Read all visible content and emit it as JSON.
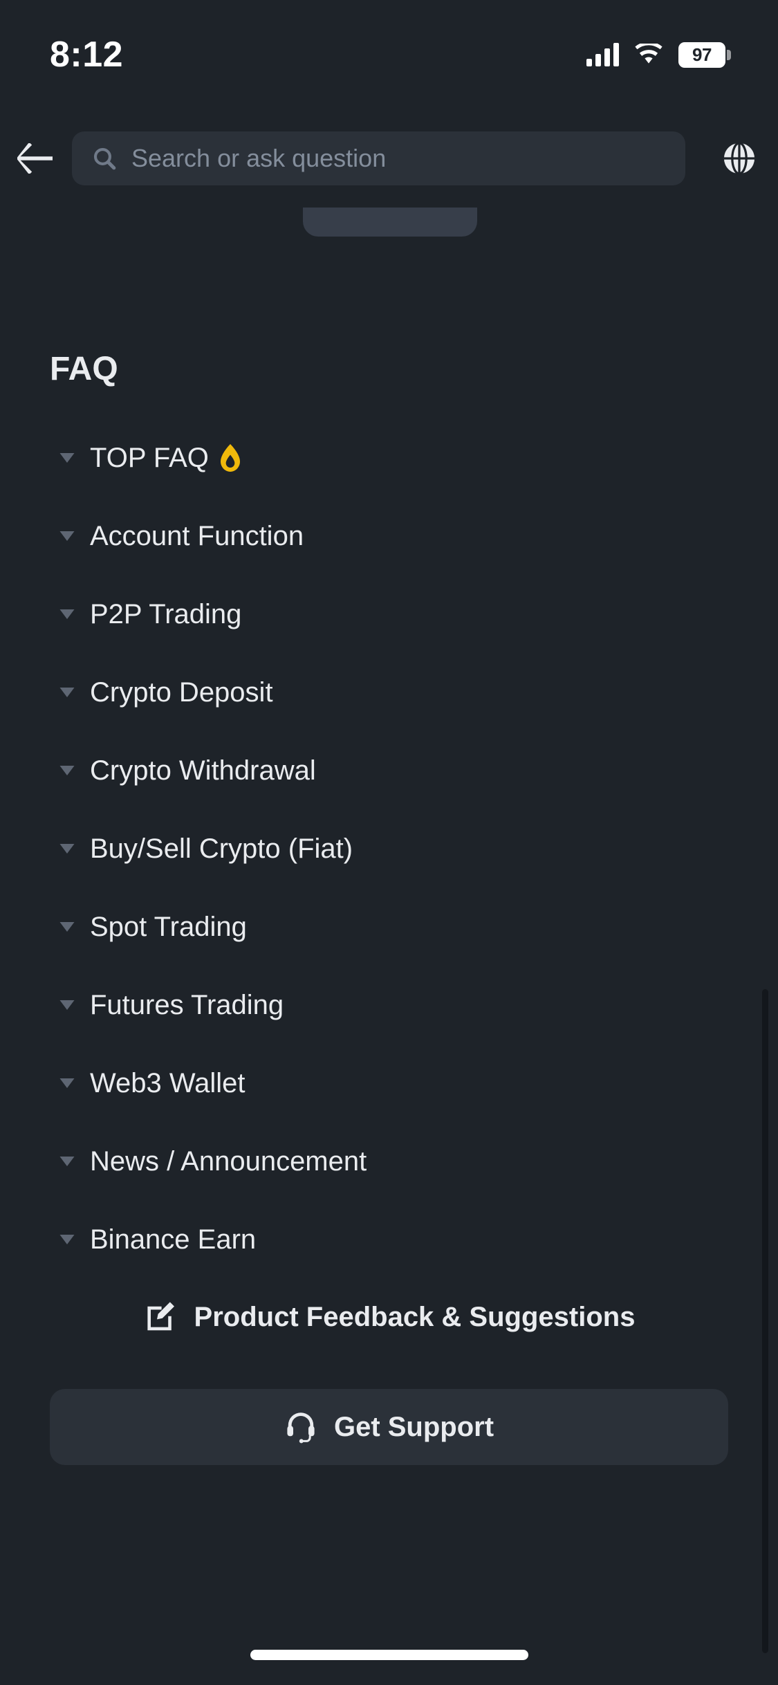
{
  "status_bar": {
    "time": "8:12",
    "battery_percent": "97",
    "signal_icon": "cellular-signal-icon",
    "wifi_icon": "wifi-icon",
    "battery_icon": "battery-icon"
  },
  "header": {
    "back_icon": "back-arrow-icon",
    "search": {
      "icon": "search-icon",
      "value": "",
      "placeholder": "Search or ask question"
    },
    "language_icon": "globe-icon"
  },
  "main": {
    "section_title": "FAQ",
    "faq_items": [
      {
        "label": "TOP FAQ",
        "badge_icon": "flame-icon",
        "chevron": "chevron-down-icon"
      },
      {
        "label": "Account Function",
        "badge_icon": null,
        "chevron": "chevron-down-icon"
      },
      {
        "label": "P2P Trading",
        "badge_icon": null,
        "chevron": "chevron-down-icon"
      },
      {
        "label": "Crypto Deposit",
        "badge_icon": null,
        "chevron": "chevron-down-icon"
      },
      {
        "label": "Crypto Withdrawal",
        "badge_icon": null,
        "chevron": "chevron-down-icon"
      },
      {
        "label": "Buy/Sell Crypto (Fiat)",
        "badge_icon": null,
        "chevron": "chevron-down-icon"
      },
      {
        "label": "Spot Trading",
        "badge_icon": null,
        "chevron": "chevron-down-icon"
      },
      {
        "label": "Futures Trading",
        "badge_icon": null,
        "chevron": "chevron-down-icon"
      },
      {
        "label": "Web3 Wallet",
        "badge_icon": null,
        "chevron": "chevron-down-icon"
      },
      {
        "label": "News / Announcement",
        "badge_icon": null,
        "chevron": "chevron-down-icon"
      },
      {
        "label": "Binance Earn",
        "badge_icon": null,
        "chevron": "chevron-down-icon"
      }
    ]
  },
  "footer": {
    "feedback_label": "Product Feedback & Suggestions",
    "feedback_icon": "edit-square-icon",
    "support_label": "Get Support",
    "support_icon": "headset-icon"
  },
  "colors": {
    "background": "#1e2329",
    "surface": "#2b3139",
    "text_primary": "#eaecef",
    "text_muted": "#848e9c",
    "accent_flame": "#f0b90b",
    "chevron": "#5e6673"
  }
}
